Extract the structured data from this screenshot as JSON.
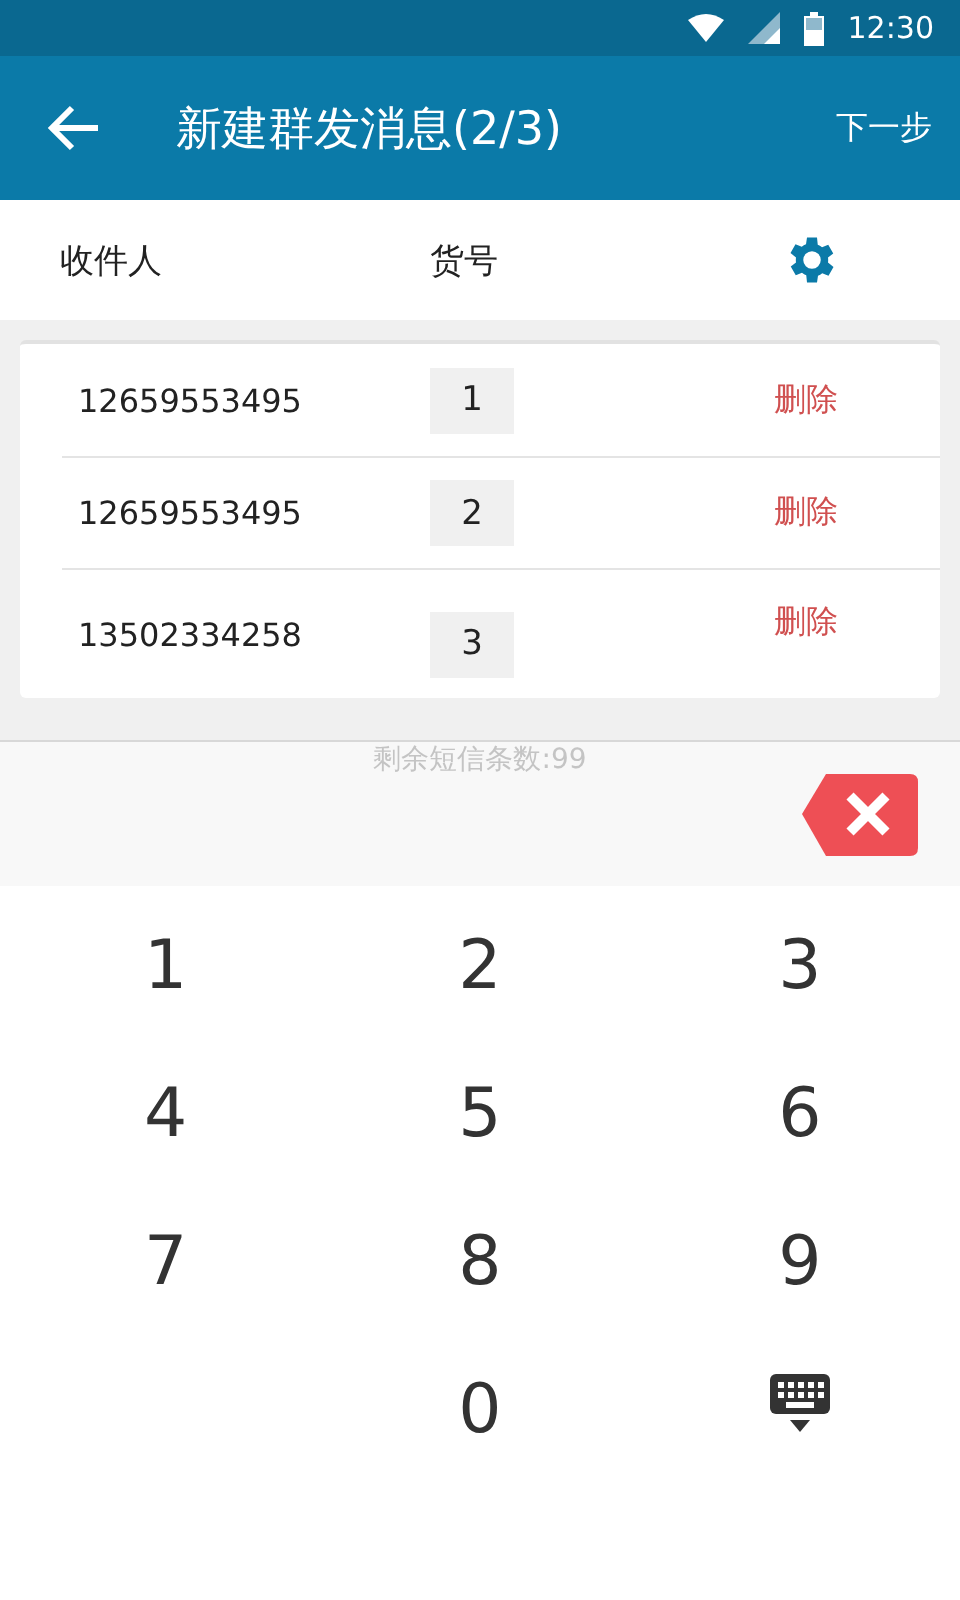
{
  "status_bar": {
    "time": "12:30"
  },
  "app_bar": {
    "title": "新建群发消息(2/3)",
    "action": "下一步"
  },
  "columns": {
    "recipient": "收件人",
    "item_no": "货号"
  },
  "rows": [
    {
      "phone": "12659553495",
      "item_no": "1",
      "delete": "删除"
    },
    {
      "phone": "12659553495",
      "item_no": "2",
      "delete": "删除"
    },
    {
      "phone": "13502334258",
      "item_no": "3",
      "delete": "删除"
    }
  ],
  "remaining": "剩余短信条数:99",
  "keypad": [
    {
      "kind": "digit",
      "label": "1"
    },
    {
      "kind": "digit",
      "label": "2"
    },
    {
      "kind": "digit",
      "label": "3"
    },
    {
      "kind": "digit",
      "label": "4"
    },
    {
      "kind": "digit",
      "label": "5"
    },
    {
      "kind": "digit",
      "label": "6"
    },
    {
      "kind": "digit",
      "label": "7"
    },
    {
      "kind": "digit",
      "label": "8"
    },
    {
      "kind": "digit",
      "label": "9"
    },
    {
      "kind": "spacer"
    },
    {
      "kind": "digit",
      "label": "0"
    },
    {
      "kind": "hide"
    }
  ]
}
